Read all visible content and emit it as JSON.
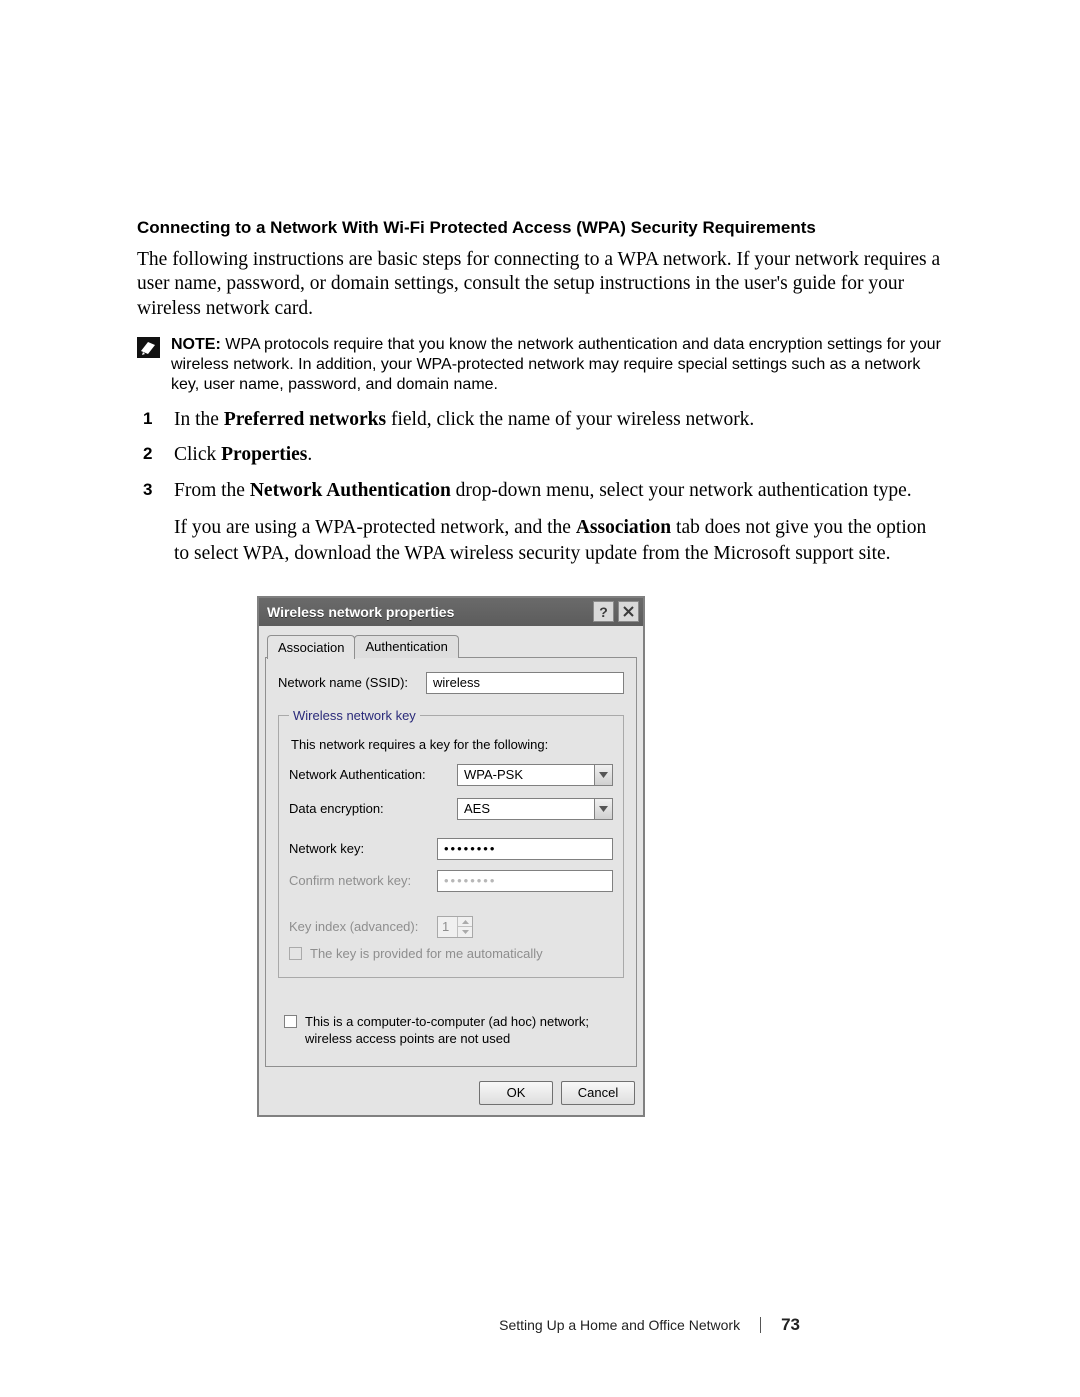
{
  "doc": {
    "heading": "Connecting to a Network With Wi-Fi Protected Access (WPA) Security Requirements",
    "intro": "The following instructions are basic steps for connecting to a WPA network. If your network requires a user name, password, or domain settings, consult the setup instructions in the user's guide for your wireless network card.",
    "note_label": "NOTE:",
    "note_body": " WPA protocols require that you know the network authentication and data encryption settings for your wireless network. In addition, your WPA-protected network may require special settings such as a network key, user name, password, and domain name.",
    "steps": {
      "s1_pre": "In the ",
      "s1_bold": "Preferred networks",
      "s1_post": " field, click the name of your wireless network.",
      "s2_pre": "Click ",
      "s2_bold": "Properties",
      "s2_post": ".",
      "s3_pre": "From the ",
      "s3_bold": "Network Authentication",
      "s3_post": " drop-down menu, select your network authentication type.",
      "s3_sub_pre": "If you are using a WPA-protected network, and the ",
      "s3_sub_bold": "Association",
      "s3_sub_post": " tab does not give you the option to select WPA, download the WPA wireless security update from the Microsoft support site."
    },
    "footer": {
      "title": "Setting Up a Home and Office Network",
      "page": "73"
    }
  },
  "dialog": {
    "title": "Wireless network properties",
    "tabs": {
      "assoc": "Association",
      "auth": "Authentication"
    },
    "ssid_label": "Network name (SSID):",
    "ssid_value": "wireless",
    "group_legend": "Wireless network key",
    "hint": "This network requires a key for the following:",
    "netauth_label": "Network Authentication:",
    "netauth_value": "WPA-PSK",
    "enc_label": "Data encryption:",
    "enc_value": "AES",
    "key_label": "Network key:",
    "key_value": "••••••••",
    "confirm_label": "Confirm network key:",
    "confirm_value": "••••••••",
    "keyindex_label": "Key index (advanced):",
    "keyindex_value": "1",
    "auto_label": "The key is provided for me automatically",
    "adhoc_label": "This is a computer-to-computer (ad hoc) network; wireless access points are not used",
    "ok": "OK",
    "cancel": "Cancel"
  }
}
